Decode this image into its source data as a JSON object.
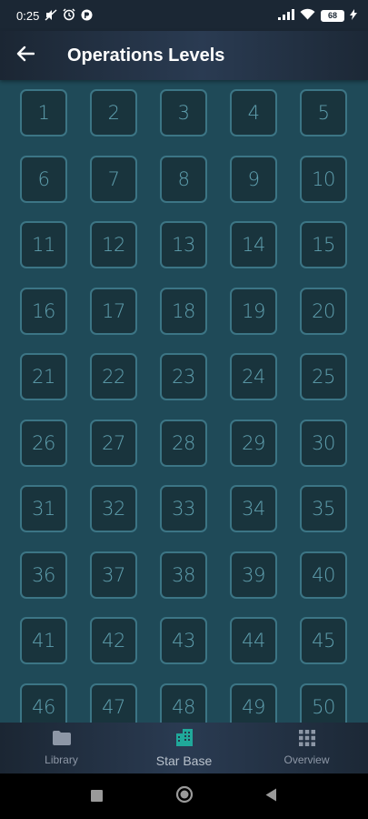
{
  "status_bar": {
    "time": "0:25",
    "battery": "68",
    "icons": [
      "mute-icon",
      "alarm-icon",
      "app-notification-icon",
      "signal-icon",
      "wifi-icon",
      "battery-icon",
      "charging-icon"
    ]
  },
  "app_bar": {
    "title": "Operations Levels",
    "back_icon": "arrow-left-icon"
  },
  "levels": [
    "1",
    "2",
    "3",
    "4",
    "5",
    "6",
    "7",
    "8",
    "9",
    "10",
    "11",
    "12",
    "13",
    "14",
    "15",
    "16",
    "17",
    "18",
    "19",
    "20",
    "21",
    "22",
    "23",
    "24",
    "25",
    "26",
    "27",
    "28",
    "29",
    "30",
    "31",
    "32",
    "33",
    "34",
    "35",
    "36",
    "37",
    "38",
    "39",
    "40",
    "41",
    "42",
    "43",
    "44",
    "45",
    "46",
    "47",
    "48",
    "49",
    "50"
  ],
  "bottom_nav": {
    "items": [
      {
        "label": "Library",
        "icon": "folder-icon",
        "active": false
      },
      {
        "label": "Star Base",
        "icon": "building-icon",
        "active": true
      },
      {
        "label": "Overview",
        "icon": "grid-icon",
        "active": false
      }
    ]
  },
  "colors": {
    "background": "#1f4a58",
    "tile": "#19343d",
    "tile_border": "#3c7585",
    "tile_text": "#5f9fae",
    "accent_active": "#20a89a"
  }
}
